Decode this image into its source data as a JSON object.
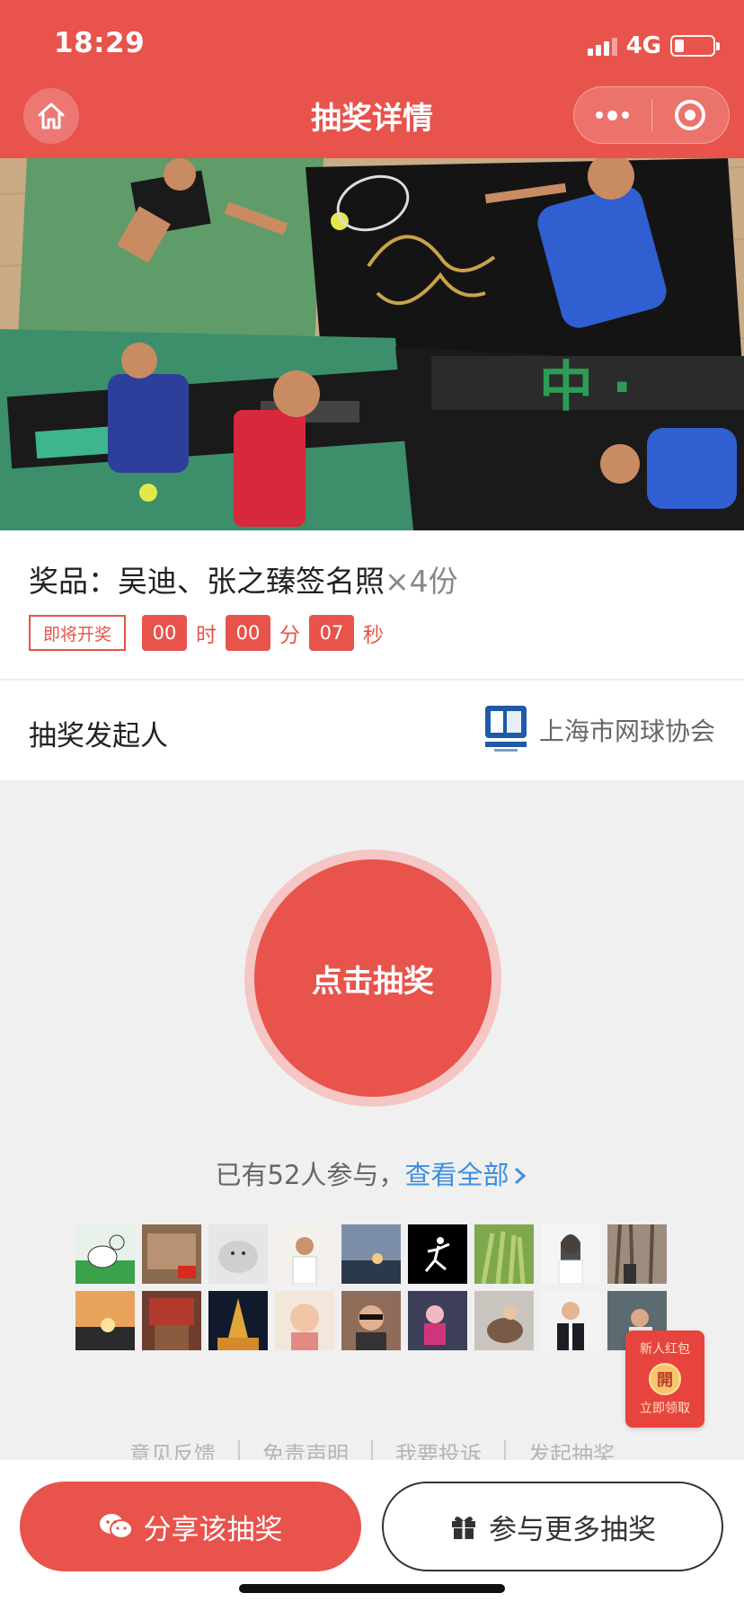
{
  "status_bar": {
    "time": "18:29",
    "network": "4G"
  },
  "nav": {
    "title": "抽奖详情",
    "home_icon": "home-icon",
    "more_icon": "more-dots-icon",
    "close_icon": "close-miniprogram-icon"
  },
  "prize": {
    "label": "奖品：",
    "name": "吴迪、张之臻签名照",
    "count": "×4份",
    "status_tag": "即将开奖",
    "countdown": {
      "hours": "00",
      "hours_unit": "时",
      "minutes": "00",
      "minutes_unit": "分",
      "seconds": "07",
      "seconds_unit": "秒"
    }
  },
  "organizer": {
    "label": "抽奖发起人",
    "name": "上海市网球协会"
  },
  "draw": {
    "button_label": "点击抽奖"
  },
  "participants": {
    "text": "已有52人参与，",
    "view_all": "查看全部"
  },
  "red_packet": {
    "top": "新人红包",
    "coin": "開",
    "bottom": "立即领取"
  },
  "footer_links": {
    "feedback": "意见反馈",
    "disclaimer": "免责声明",
    "complain": "我要投诉",
    "create": "发起抽奖",
    "sep": "|"
  },
  "actions": {
    "share": "分享该抽奖",
    "more": "参与更多抽奖"
  },
  "colors": {
    "primary": "#e8534c",
    "link": "#3d8ee0"
  }
}
